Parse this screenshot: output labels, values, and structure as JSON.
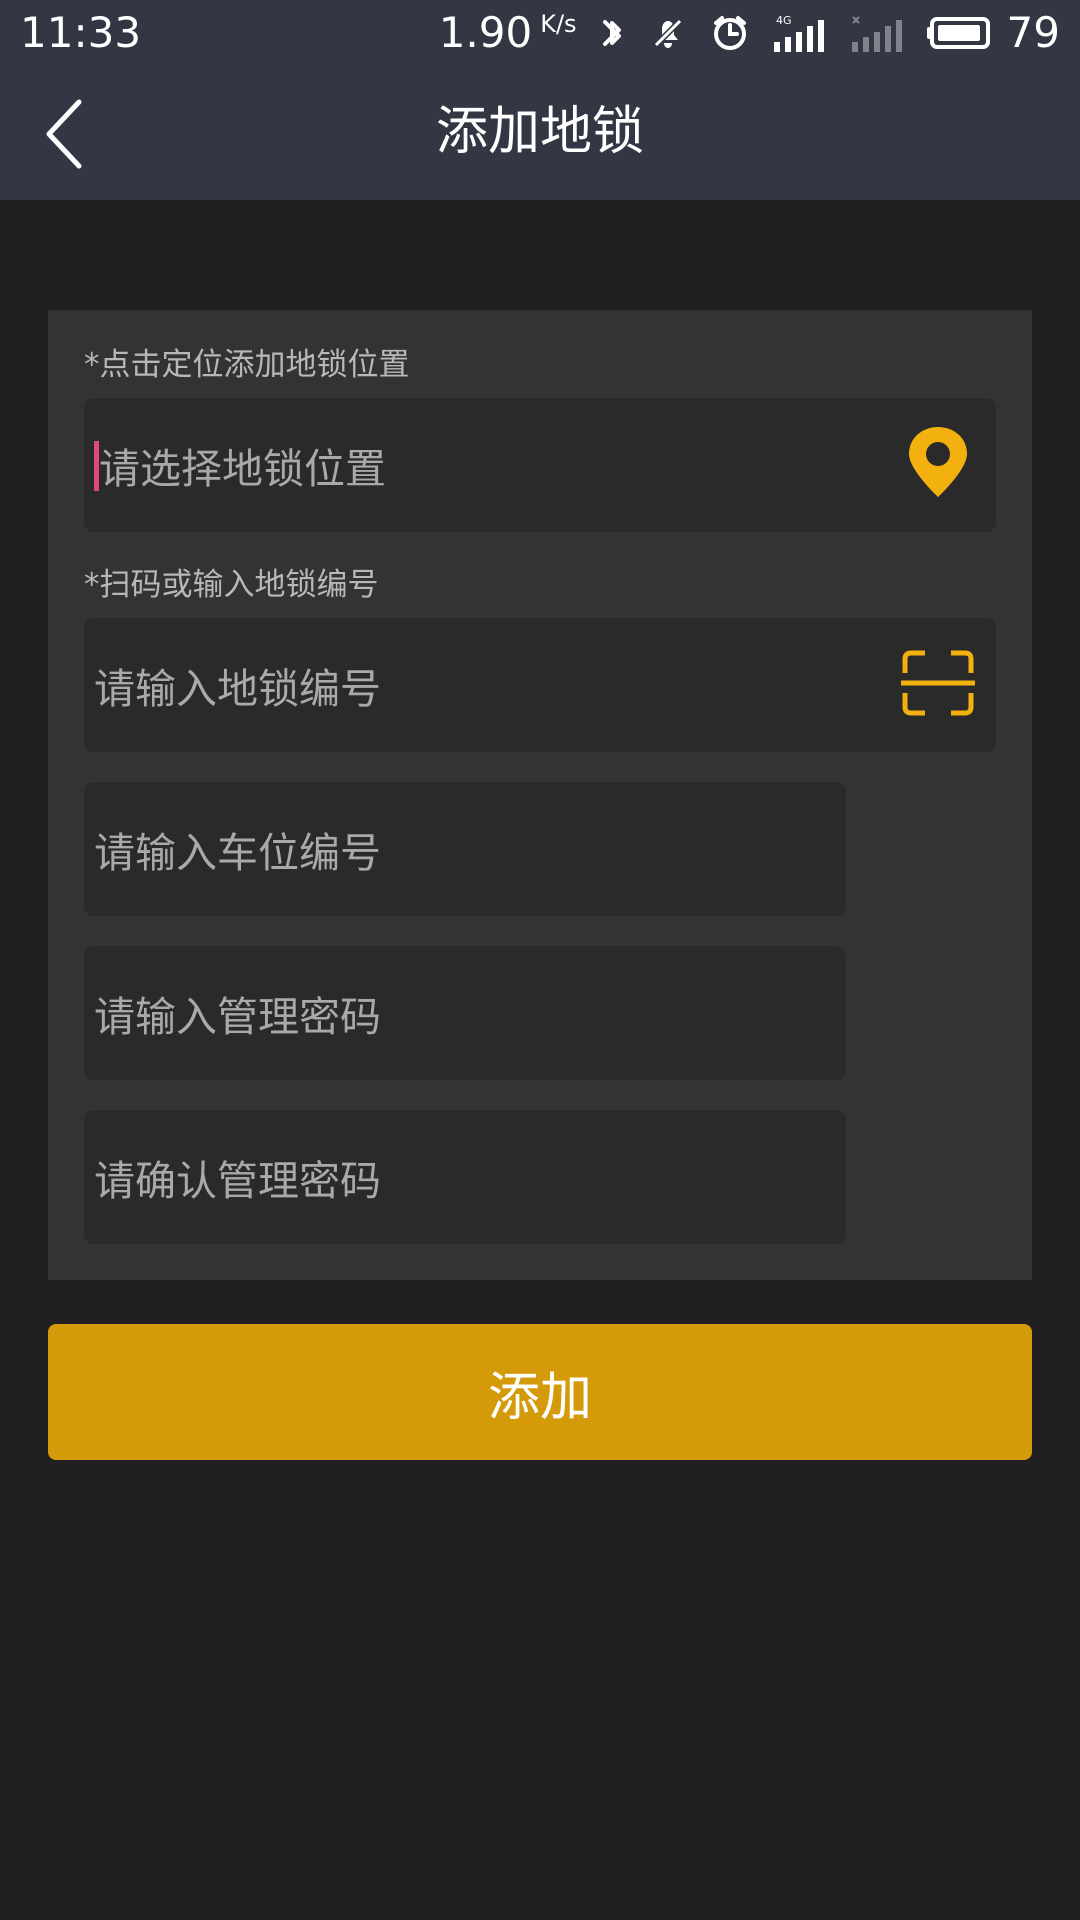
{
  "status_bar": {
    "time": "11:33",
    "network_speed": "1.90",
    "network_speed_unit": "K/s",
    "battery": "79",
    "icons": [
      "bluetooth-icon",
      "bell-off-icon",
      "alarm-icon",
      "signal-4g-icon",
      "signal-empty-icon",
      "battery-icon"
    ]
  },
  "header": {
    "title": "添加地锁",
    "back_icon": "chevron-left-icon"
  },
  "form": {
    "location": {
      "label": "*点击定位添加地锁位置",
      "placeholder": "请选择地锁位置",
      "icon": "location-pin-icon"
    },
    "lock_number": {
      "label": "*扫码或输入地锁编号",
      "placeholder": "请输入地锁编号",
      "icon": "scan-icon"
    },
    "parking_number": {
      "placeholder": "请输入车位编号"
    },
    "admin_password": {
      "placeholder": "请输入管理密码"
    },
    "confirm_password": {
      "placeholder": "请确认管理密码"
    }
  },
  "submit_button": {
    "label": "添加"
  },
  "colors": {
    "header_background": "#323743",
    "page_background": "#202020",
    "panel_background": "#333333",
    "field_background": "#2a2a2a",
    "accent": "#f2b10f",
    "button_background": "#d49a09",
    "cursor": "#e0487a"
  }
}
